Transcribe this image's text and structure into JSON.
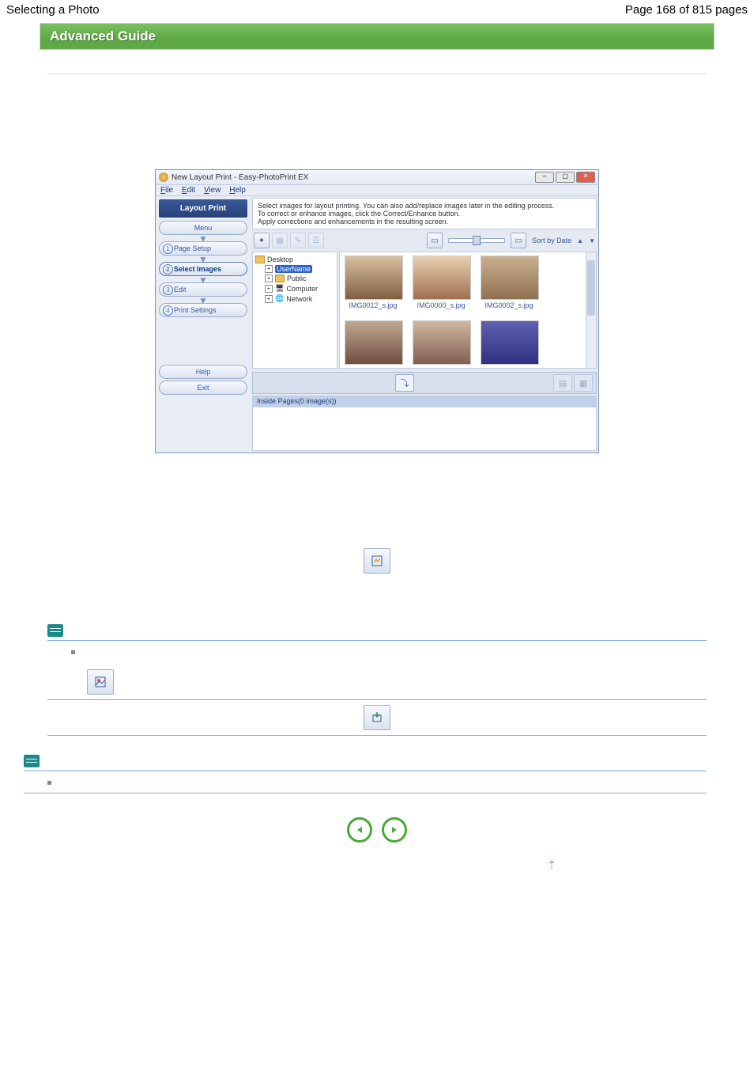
{
  "header": {
    "left": "Selecting a Photo",
    "right": "Page 168 of 815 pages"
  },
  "bar": {
    "title": "Advanced Guide"
  },
  "window": {
    "title": "New Layout Print - Easy-PhotoPrint EX",
    "menus": {
      "file": "File",
      "edit": "Edit",
      "view": "View",
      "help": "Help"
    },
    "left_title": "Layout Print",
    "menu_btn": "Menu",
    "steps": {
      "s1": "Page Setup",
      "s2": "Select Images",
      "s3": "Edit",
      "s4": "Print Settings"
    },
    "help_btn": "Help",
    "exit_btn": "Exit",
    "instructions": "Select images for layout printing. You can also add/replace images later in the editing process.\nTo correct or enhance images, click the Correct/Enhance button.\nApply corrections and enhancements in the resulting screen.",
    "sort_label": "Sort by Date",
    "tree": {
      "root": "Desktop",
      "user": "UserName",
      "public": "Public",
      "computer": "Computer",
      "network": "Network"
    },
    "thumbs": [
      "IMG0012_s.jpg",
      "IMG0000_s.jpg",
      "IMG0002_s.jpg"
    ],
    "inside_label": "Inside Pages(0 image(s))"
  }
}
